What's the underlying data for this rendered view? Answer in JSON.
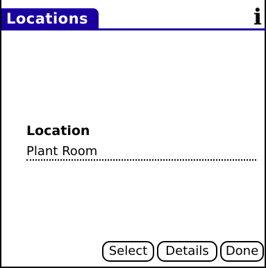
{
  "header": {
    "title": "Locations",
    "info_icon": "info-icon",
    "info_glyph": "i",
    "accent_color": "#1a00a0"
  },
  "form": {
    "location_label": "Location",
    "location_value": "Plant Room"
  },
  "buttons": {
    "select_label": "Select",
    "details_label": "Details",
    "done_label": "Done"
  }
}
